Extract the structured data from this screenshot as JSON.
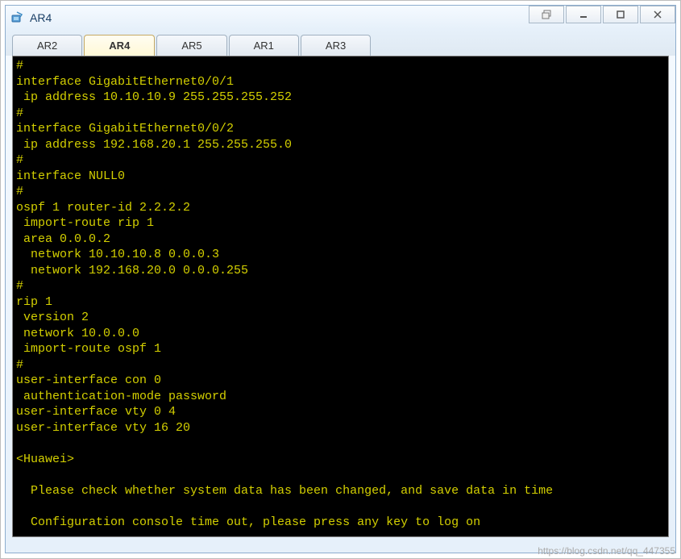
{
  "window": {
    "title": "AR4"
  },
  "tabs": [
    {
      "label": "AR2",
      "active": false
    },
    {
      "label": "AR4",
      "active": true
    },
    {
      "label": "AR5",
      "active": false
    },
    {
      "label": "AR1",
      "active": false
    },
    {
      "label": "AR3",
      "active": false
    }
  ],
  "terminal": {
    "content": "#\ninterface GigabitEthernet0/0/1\n ip address 10.10.10.9 255.255.255.252\n#\ninterface GigabitEthernet0/0/2\n ip address 192.168.20.1 255.255.255.0\n#\ninterface NULL0\n#\nospf 1 router-id 2.2.2.2\n import-route rip 1\n area 0.0.0.2\n  network 10.10.10.8 0.0.0.3\n  network 192.168.20.0 0.0.0.255\n#\nrip 1\n version 2\n network 10.0.0.0\n import-route ospf 1\n#\nuser-interface con 0\n authentication-mode password\nuser-interface vty 0 4\nuser-interface vty 16 20\n\n<Huawei>\n\n  Please check whether system data has been changed, and save data in time\n\n  Configuration console time out, please press any key to log on\n"
  },
  "watermark": "https://blog.csdn.net/qq_447355"
}
